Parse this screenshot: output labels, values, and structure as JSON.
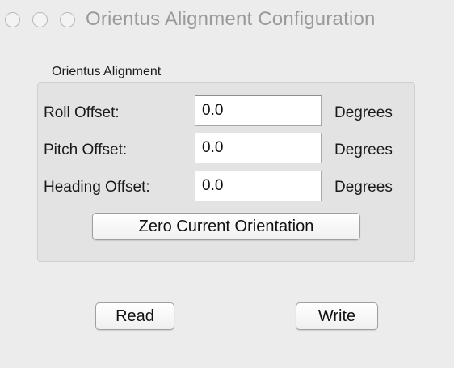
{
  "window": {
    "title": "Orientus Alignment Configuration"
  },
  "group": {
    "label": "Orientus Alignment"
  },
  "fields": [
    {
      "label": "Roll Offset:",
      "value": "0.0",
      "unit": "Degrees"
    },
    {
      "label": "Pitch Offset:",
      "value": "0.0",
      "unit": "Degrees"
    },
    {
      "label": "Heading Offset:",
      "value": "0.0",
      "unit": "Degrees"
    }
  ],
  "buttons": {
    "zero": "Zero Current Orientation",
    "read": "Read",
    "write": "Write"
  }
}
